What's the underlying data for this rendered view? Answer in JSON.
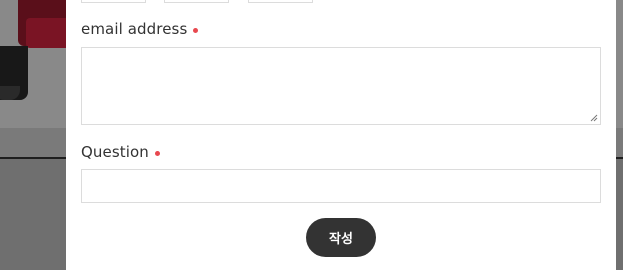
{
  "form": {
    "email_label": "email address",
    "question_label": "Question",
    "submit_label": "작성"
  },
  "colors": {
    "required_dot": "#e8484f",
    "submit_button": "#333333",
    "field_border": "#dcdcdc"
  }
}
